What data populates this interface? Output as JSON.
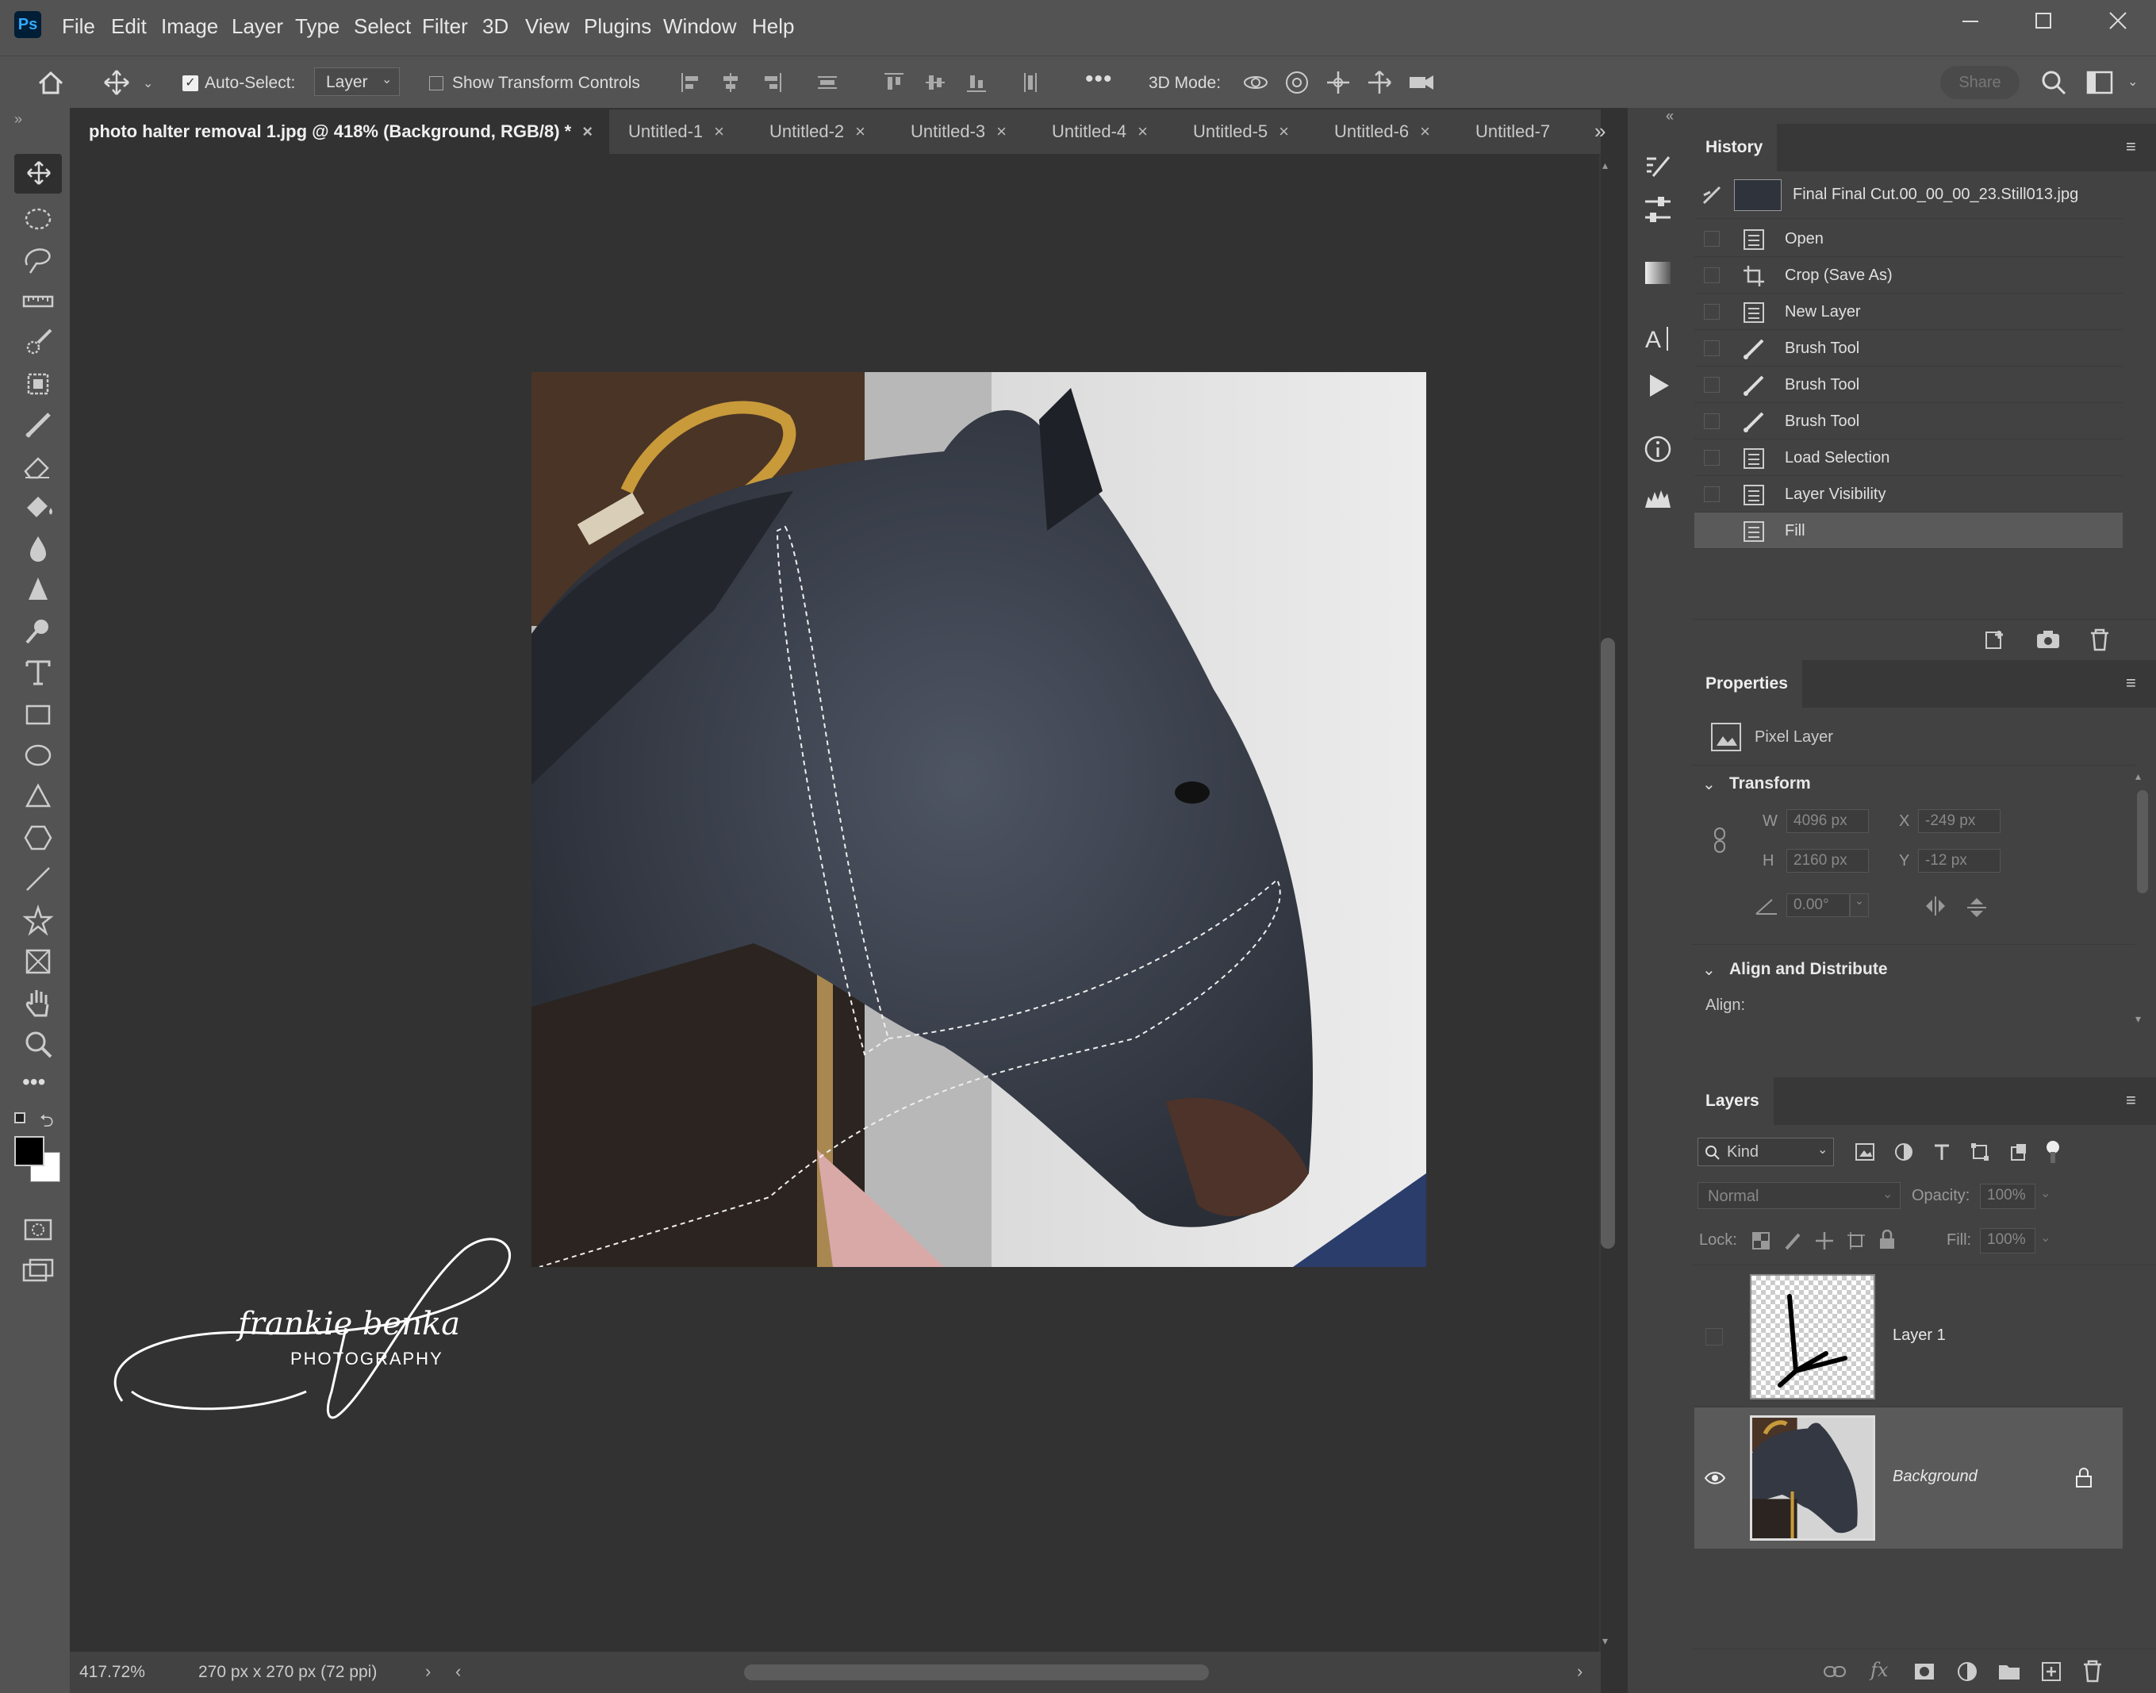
{
  "app": {
    "logo": "Ps"
  },
  "menubar": {
    "items": [
      "File",
      "Edit",
      "Image",
      "Layer",
      "Type",
      "Select",
      "Filter",
      "3D",
      "View",
      "Plugins",
      "Window",
      "Help"
    ]
  },
  "options": {
    "auto_select_label": "Auto-Select:",
    "auto_select_value": "Layer",
    "show_transform_label": "Show Transform Controls",
    "mode3d_label": "3D Mode:",
    "share_label": "Share"
  },
  "tabs": [
    {
      "label": "photo halter removal 1.jpg @ 418% (Background, RGB/8) *",
      "active": true
    },
    {
      "label": "Untitled-1"
    },
    {
      "label": "Untitled-2"
    },
    {
      "label": "Untitled-3"
    },
    {
      "label": "Untitled-4"
    },
    {
      "label": "Untitled-5"
    },
    {
      "label": "Untitled-6"
    },
    {
      "label": "Untitled-7"
    }
  ],
  "watermark": {
    "name": "frankie benka",
    "sub": "PHOTOGRAPHY"
  },
  "status": {
    "zoom": "417.72%",
    "doc_size": "270 px x 270 px (72 ppi)"
  },
  "history": {
    "title": "History",
    "snapshot": "Final Final Cut.00_00_00_23.Still013.jpg",
    "items": [
      {
        "label": "Open",
        "icon": "document-icon"
      },
      {
        "label": "Crop (Save As)",
        "icon": "crop-icon"
      },
      {
        "label": "New Layer",
        "icon": "document-icon"
      },
      {
        "label": "Brush Tool",
        "icon": "brush-icon"
      },
      {
        "label": "Brush Tool",
        "icon": "brush-icon"
      },
      {
        "label": "Brush Tool",
        "icon": "brush-icon"
      },
      {
        "label": "Load Selection",
        "icon": "document-icon"
      },
      {
        "label": "Layer Visibility",
        "icon": "document-icon"
      },
      {
        "label": "Fill",
        "icon": "document-icon",
        "selected": true
      }
    ]
  },
  "properties": {
    "title": "Properties",
    "kind": "Pixel Layer",
    "transform_title": "Transform",
    "w_label": "W",
    "w": "4096 px",
    "h_label": "H",
    "h": "2160 px",
    "x_label": "X",
    "x": "-249 px",
    "y_label": "Y",
    "y": "-12 px",
    "angle": "0.00°",
    "align_title": "Align and Distribute",
    "align_label": "Align:"
  },
  "layers": {
    "title": "Layers",
    "filter": "Kind",
    "blend": "Normal",
    "opacity_label": "Opacity:",
    "opacity": "100%",
    "lock_label": "Lock:",
    "fill_label": "Fill:",
    "fill": "100%",
    "items": [
      {
        "name": "Layer 1",
        "visible": false
      },
      {
        "name": "Background",
        "visible": true,
        "locked": true
      }
    ]
  },
  "colors": {
    "ui_dark": "#323232",
    "ui_mid": "#424242",
    "ui_light": "#535353",
    "highlight": "#5a5a5a"
  }
}
